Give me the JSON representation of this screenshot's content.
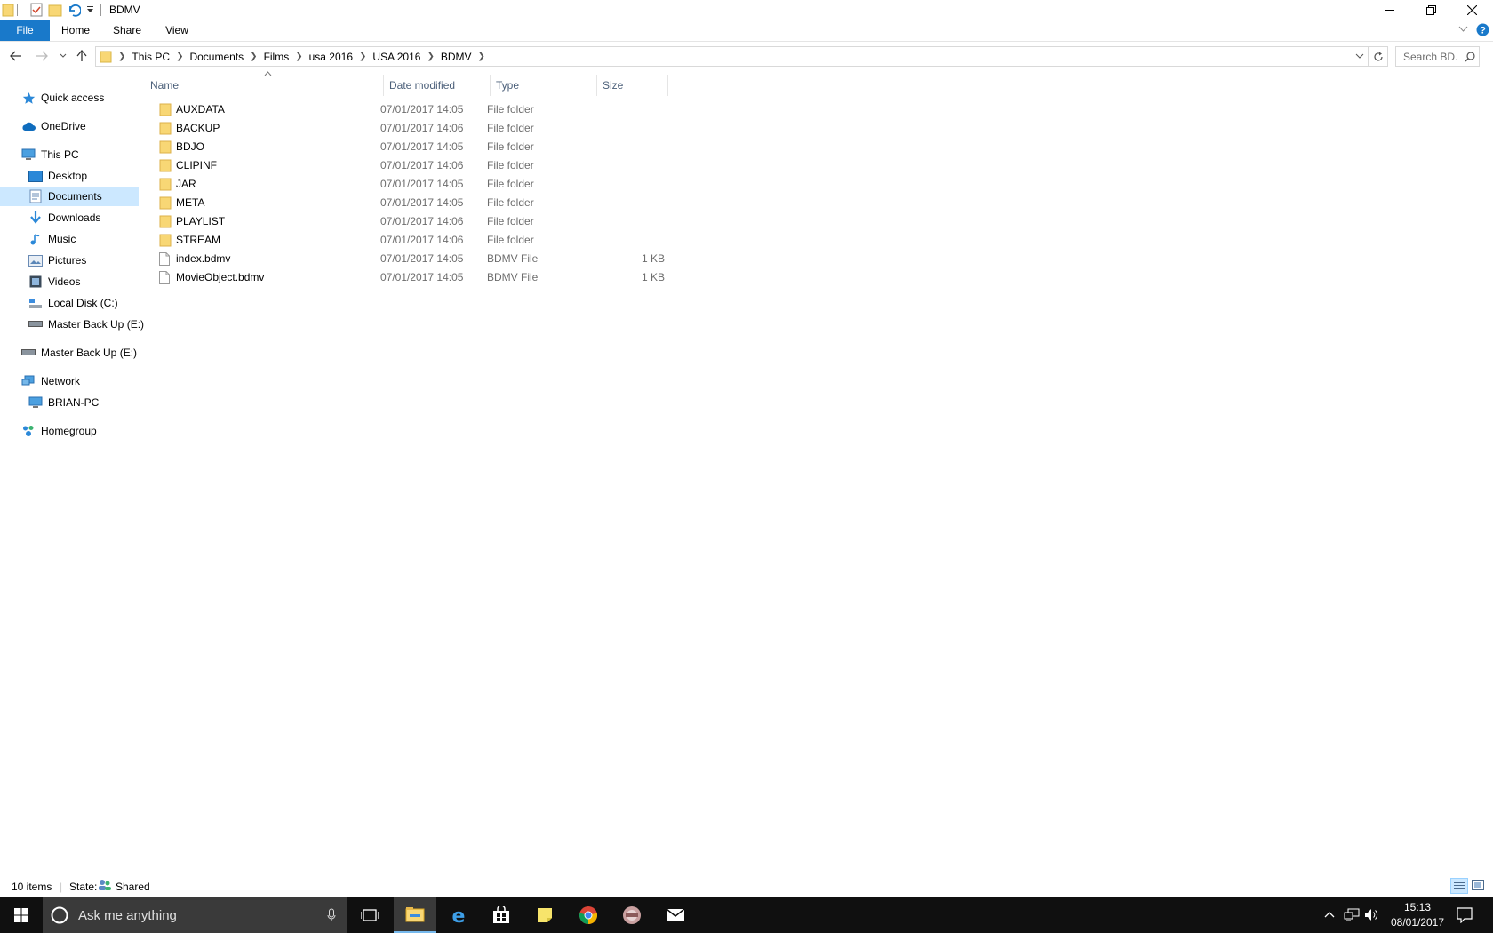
{
  "window": {
    "title": "BDMV"
  },
  "ribbon": {
    "tabs": [
      {
        "label": "File"
      },
      {
        "label": "Home"
      },
      {
        "label": "Share"
      },
      {
        "label": "View"
      }
    ]
  },
  "address": {
    "crumbs": [
      "This PC",
      "Documents",
      "Films",
      "usa 2016",
      "USA 2016",
      "BDMV"
    ],
    "search_placeholder": "Search BD..."
  },
  "nav": {
    "items": [
      {
        "label": "Quick access",
        "icon": "star-icon"
      },
      {
        "label": "OneDrive",
        "icon": "cloud-icon"
      },
      {
        "label": "This PC",
        "icon": "computer-icon"
      },
      {
        "label": "Desktop",
        "icon": "desktop-folder-icon"
      },
      {
        "label": "Documents",
        "icon": "documents-icon"
      },
      {
        "label": "Downloads",
        "icon": "download-icon"
      },
      {
        "label": "Music",
        "icon": "music-icon"
      },
      {
        "label": "Pictures",
        "icon": "pictures-icon"
      },
      {
        "label": "Videos",
        "icon": "videos-icon"
      },
      {
        "label": "Local Disk (C:)",
        "icon": "local-disk-icon"
      },
      {
        "label": "Master Back Up (E:)",
        "icon": "drive-icon"
      },
      {
        "label": "Master Back Up (E:)",
        "icon": "drive-icon"
      },
      {
        "label": "Network",
        "icon": "network-icon"
      },
      {
        "label": "BRIAN-PC",
        "icon": "computer-icon"
      },
      {
        "label": "Homegroup",
        "icon": "homegroup-icon"
      }
    ],
    "selected": "Documents"
  },
  "filelist": {
    "columns": [
      {
        "label": "Name"
      },
      {
        "label": "Date modified"
      },
      {
        "label": "Type"
      },
      {
        "label": "Size"
      }
    ],
    "rows": [
      {
        "name": "AUXDATA",
        "date": "07/01/2017 14:05",
        "type": "File folder",
        "size": "",
        "kind": "folder"
      },
      {
        "name": "BACKUP",
        "date": "07/01/2017 14:06",
        "type": "File folder",
        "size": "",
        "kind": "folder"
      },
      {
        "name": "BDJO",
        "date": "07/01/2017 14:05",
        "type": "File folder",
        "size": "",
        "kind": "folder"
      },
      {
        "name": "CLIPINF",
        "date": "07/01/2017 14:06",
        "type": "File folder",
        "size": "",
        "kind": "folder"
      },
      {
        "name": "JAR",
        "date": "07/01/2017 14:05",
        "type": "File folder",
        "size": "",
        "kind": "folder"
      },
      {
        "name": "META",
        "date": "07/01/2017 14:05",
        "type": "File folder",
        "size": "",
        "kind": "folder"
      },
      {
        "name": "PLAYLIST",
        "date": "07/01/2017 14:06",
        "type": "File folder",
        "size": "",
        "kind": "folder"
      },
      {
        "name": "STREAM",
        "date": "07/01/2017 14:06",
        "type": "File folder",
        "size": "",
        "kind": "folder"
      },
      {
        "name": "index.bdmv",
        "date": "07/01/2017 14:05",
        "type": "BDMV File",
        "size": "1 KB",
        "kind": "file"
      },
      {
        "name": "MovieObject.bdmv",
        "date": "07/01/2017 14:05",
        "type": "BDMV File",
        "size": "1 KB",
        "kind": "file"
      }
    ]
  },
  "status": {
    "count": "10 items",
    "state_label": "State:",
    "state_value": "Shared"
  },
  "taskbar": {
    "search_placeholder": "Ask me anything",
    "time": "15:13",
    "date": "08/01/2017"
  },
  "colors": {
    "accent": "#1979ca",
    "selected_bg": "#cce8ff",
    "folder": "#f8d775",
    "taskbar": "#101010"
  }
}
